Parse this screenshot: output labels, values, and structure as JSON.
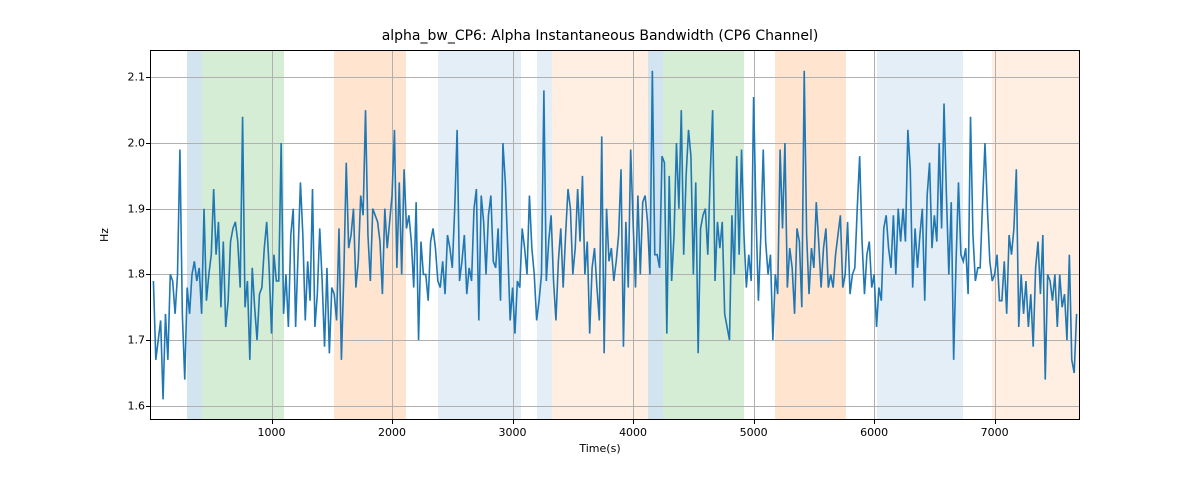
{
  "chart_data": {
    "type": "line",
    "title": "alpha_bw_CP6: Alpha Instantaneous Bandwidth (CP6 Channel)",
    "xlabel": "Time(s)",
    "ylabel": "Hz",
    "xlim": [
      0,
      7700
    ],
    "ylim": [
      1.58,
      2.14
    ],
    "x_ticks": [
      1000,
      2000,
      3000,
      4000,
      5000,
      6000,
      7000
    ],
    "y_ticks": [
      1.6,
      1.7,
      1.8,
      1.9,
      2.0,
      2.1
    ],
    "regions": [
      {
        "color": "blue",
        "x0": 300,
        "x1": 420
      },
      {
        "color": "green",
        "x0": 420,
        "x1": 1100
      },
      {
        "color": "orange",
        "x0": 1520,
        "x1": 2120
      },
      {
        "color": "blue-light",
        "x0": 2380,
        "x1": 3070
      },
      {
        "color": "blue-light",
        "x0": 3200,
        "x1": 3330
      },
      {
        "color": "orange-light",
        "x0": 3330,
        "x1": 4120
      },
      {
        "color": "blue",
        "x0": 4120,
        "x1": 4250
      },
      {
        "color": "green",
        "x0": 4250,
        "x1": 4920
      },
      {
        "color": "orange",
        "x0": 5180,
        "x1": 5770
      },
      {
        "color": "blue-light",
        "x0": 6020,
        "x1": 6110
      },
      {
        "color": "blue-light",
        "x0": 6110,
        "x1": 6740
      },
      {
        "color": "orange-light",
        "x0": 6980,
        "x1": 7130
      },
      {
        "color": "orange-light",
        "x0": 7130,
        "x1": 7700
      }
    ],
    "x": [
      20,
      40,
      60,
      80,
      100,
      120,
      140,
      160,
      180,
      200,
      220,
      240,
      260,
      280,
      300,
      320,
      340,
      360,
      380,
      400,
      420,
      440,
      460,
      480,
      500,
      520,
      540,
      560,
      580,
      600,
      620,
      640,
      660,
      680,
      700,
      720,
      740,
      760,
      780,
      800,
      820,
      840,
      860,
      880,
      900,
      920,
      940,
      960,
      980,
      1000,
      1020,
      1040,
      1060,
      1080,
      1100,
      1120,
      1140,
      1160,
      1180,
      1200,
      1220,
      1240,
      1260,
      1280,
      1300,
      1320,
      1340,
      1360,
      1380,
      1400,
      1420,
      1440,
      1460,
      1480,
      1500,
      1520,
      1540,
      1560,
      1580,
      1600,
      1620,
      1640,
      1660,
      1680,
      1700,
      1720,
      1740,
      1760,
      1780,
      1800,
      1820,
      1840,
      1860,
      1880,
      1900,
      1920,
      1940,
      1960,
      1980,
      2000,
      2020,
      2040,
      2060,
      2080,
      2100,
      2120,
      2140,
      2160,
      2180,
      2200,
      2220,
      2240,
      2260,
      2280,
      2300,
      2320,
      2340,
      2360,
      2380,
      2400,
      2420,
      2440,
      2460,
      2480,
      2500,
      2520,
      2540,
      2560,
      2580,
      2600,
      2620,
      2640,
      2660,
      2680,
      2700,
      2720,
      2740,
      2760,
      2780,
      2800,
      2820,
      2840,
      2860,
      2880,
      2900,
      2920,
      2940,
      2960,
      2980,
      3000,
      3020,
      3040,
      3060,
      3080,
      3100,
      3120,
      3140,
      3160,
      3180,
      3200,
      3220,
      3240,
      3260,
      3280,
      3300,
      3320,
      3340,
      3360,
      3380,
      3400,
      3420,
      3440,
      3460,
      3480,
      3500,
      3520,
      3540,
      3560,
      3580,
      3600,
      3620,
      3640,
      3660,
      3680,
      3700,
      3720,
      3740,
      3760,
      3780,
      3800,
      3820,
      3840,
      3860,
      3880,
      3900,
      3920,
      3940,
      3960,
      3980,
      4000,
      4020,
      4040,
      4060,
      4080,
      4100,
      4120,
      4140,
      4160,
      4180,
      4200,
      4220,
      4240,
      4260,
      4280,
      4300,
      4320,
      4340,
      4360,
      4380,
      4400,
      4420,
      4440,
      4460,
      4480,
      4500,
      4520,
      4540,
      4560,
      4580,
      4600,
      4620,
      4640,
      4660,
      4680,
      4700,
      4720,
      4740,
      4760,
      4780,
      4800,
      4820,
      4840,
      4860,
      4880,
      4900,
      4920,
      4940,
      4960,
      4980,
      5000,
      5020,
      5040,
      5060,
      5080,
      5100,
      5120,
      5140,
      5160,
      5180,
      5200,
      5220,
      5240,
      5260,
      5280,
      5300,
      5320,
      5340,
      5360,
      5380,
      5400,
      5420,
      5440,
      5460,
      5480,
      5500,
      5520,
      5540,
      5560,
      5580,
      5600,
      5620,
      5640,
      5660,
      5680,
      5700,
      5720,
      5740,
      5760,
      5780,
      5800,
      5820,
      5840,
      5860,
      5880,
      5900,
      5920,
      5940,
      5960,
      5980,
      6000,
      6020,
      6040,
      6060,
      6080,
      6100,
      6120,
      6140,
      6160,
      6180,
      6200,
      6220,
      6240,
      6260,
      6280,
      6300,
      6320,
      6340,
      6360,
      6380,
      6400,
      6420,
      6440,
      6460,
      6480,
      6500,
      6520,
      6540,
      6560,
      6580,
      6600,
      6620,
      6640,
      6660,
      6680,
      6700,
      6720,
      6740,
      6760,
      6780,
      6800,
      6820,
      6840,
      6860,
      6880,
      6900,
      6920,
      6940,
      6960,
      6980,
      7000,
      7020,
      7040,
      7060,
      7080,
      7100,
      7120,
      7140,
      7160,
      7180,
      7200,
      7220,
      7240,
      7260,
      7280,
      7300,
      7320,
      7340,
      7360,
      7380,
      7400,
      7420,
      7440,
      7460,
      7480,
      7500,
      7520,
      7540,
      7560,
      7580,
      7600,
      7620,
      7640,
      7660,
      7680
    ],
    "values": [
      1.79,
      1.67,
      1.7,
      1.73,
      1.61,
      1.74,
      1.67,
      1.8,
      1.79,
      1.74,
      1.8,
      1.99,
      1.74,
      1.64,
      1.78,
      1.74,
      1.8,
      1.82,
      1.79,
      1.81,
      1.74,
      1.9,
      1.76,
      1.8,
      1.83,
      1.93,
      1.83,
      1.88,
      1.75,
      1.85,
      1.72,
      1.76,
      1.85,
      1.87,
      1.88,
      1.85,
      1.78,
      2.04,
      1.75,
      1.79,
      1.67,
      1.81,
      1.75,
      1.7,
      1.77,
      1.78,
      1.84,
      1.88,
      1.81,
      1.71,
      1.83,
      1.79,
      1.79,
      2.0,
      1.74,
      1.8,
      1.72,
      1.86,
      1.9,
      1.72,
      1.83,
      1.94,
      1.86,
      1.73,
      1.82,
      1.76,
      1.93,
      1.72,
      1.77,
      1.87,
      1.79,
      1.69,
      1.81,
      1.68,
      1.78,
      1.77,
      1.73,
      1.87,
      1.67,
      1.8,
      1.97,
      1.84,
      1.86,
      1.9,
      1.78,
      1.82,
      1.92,
      1.89,
      2.05,
      1.86,
      1.79,
      1.9,
      1.89,
      1.88,
      1.85,
      1.77,
      1.9,
      1.84,
      1.88,
      1.92,
      2.02,
      1.81,
      1.94,
      1.8,
      1.96,
      1.87,
      1.89,
      1.85,
      1.78,
      1.91,
      1.7,
      1.85,
      1.8,
      1.8,
      1.76,
      1.85,
      1.87,
      1.84,
      1.79,
      1.78,
      1.82,
      1.77,
      1.86,
      1.84,
      1.81,
      1.9,
      2.02,
      1.79,
      1.82,
      1.86,
      1.77,
      1.81,
      1.79,
      1.9,
      1.93,
      1.73,
      1.92,
      1.88,
      1.8,
      1.89,
      1.92,
      1.82,
      1.81,
      1.87,
      1.76,
      2.0,
      1.94,
      1.84,
      1.73,
      1.78,
      1.71,
      1.79,
      1.78,
      1.87,
      1.84,
      1.8,
      1.92,
      1.84,
      1.8,
      1.73,
      1.76,
      1.8,
      2.08,
      1.79,
      1.85,
      1.89,
      1.79,
      1.73,
      1.82,
      1.87,
      1.78,
      1.86,
      1.93,
      1.9,
      1.8,
      1.84,
      1.93,
      1.85,
      1.95,
      1.8,
      1.85,
      1.71,
      1.81,
      1.84,
      1.78,
      1.73,
      2.01,
      1.68,
      1.9,
      1.82,
      1.84,
      1.79,
      1.82,
      1.86,
      1.96,
      1.69,
      1.88,
      1.78,
      1.99,
      1.88,
      1.78,
      1.92,
      1.8,
      1.91,
      1.92,
      1.88,
      1.8,
      2.11,
      1.83,
      1.83,
      1.81,
      1.98,
      1.97,
      1.71,
      1.95,
      1.79,
      1.86,
      2.0,
      1.9,
      2.05,
      1.83,
      1.95,
      2.02,
      1.98,
      1.8,
      1.94,
      1.68,
      1.87,
      1.89,
      1.9,
      1.83,
      1.95,
      2.05,
      1.79,
      1.88,
      1.84,
      1.88,
      1.74,
      1.72,
      1.7,
      1.89,
      1.8,
      1.98,
      1.83,
      1.99,
      1.86,
      1.78,
      1.83,
      1.79,
      2.07,
      1.89,
      1.76,
      1.86,
      1.99,
      1.85,
      1.8,
      1.83,
      1.7,
      1.8,
      1.77,
      1.99,
      1.87,
      2.0,
      1.78,
      1.84,
      1.81,
      1.74,
      1.87,
      1.85,
      1.75,
      2.11,
      1.86,
      1.77,
      1.84,
      1.81,
      1.91,
      1.85,
      1.78,
      1.84,
      1.87,
      1.78,
      1.8,
      1.78,
      1.83,
      1.86,
      1.89,
      1.78,
      1.8,
      1.88,
      1.77,
      1.8,
      1.81,
      1.9,
      1.98,
      1.85,
      1.77,
      1.83,
      1.85,
      1.78,
      1.8,
      1.72,
      1.78,
      1.76,
      1.87,
      1.89,
      1.84,
      1.81,
      1.89,
      1.8,
      1.9,
      1.85,
      1.9,
      1.85,
      2.02,
      1.96,
      1.78,
      1.87,
      1.81,
      1.86,
      1.9,
      1.76,
      1.92,
      1.97,
      1.84,
      1.89,
      1.85,
      2.0,
      1.87,
      2.06,
      1.92,
      1.8,
      1.91,
      1.67,
      1.82,
      1.94,
      1.83,
      1.82,
      1.84,
      1.77,
      2.04,
      1.86,
      1.79,
      1.81,
      1.81,
      1.91,
      2.0,
      1.9,
      1.82,
      1.79,
      1.8,
      1.83,
      1.76,
      1.76,
      1.82,
      1.74,
      1.86,
      1.83,
      1.87,
      1.96,
      1.72,
      1.8,
      1.74,
      1.79,
      1.72,
      1.77,
      1.69,
      1.81,
      1.85,
      1.77,
      1.86,
      1.64,
      1.8,
      1.79,
      1.76,
      1.8,
      1.72,
      1.8,
      1.75,
      1.77,
      1.7,
      1.83,
      1.67,
      1.65,
      1.74
    ]
  }
}
